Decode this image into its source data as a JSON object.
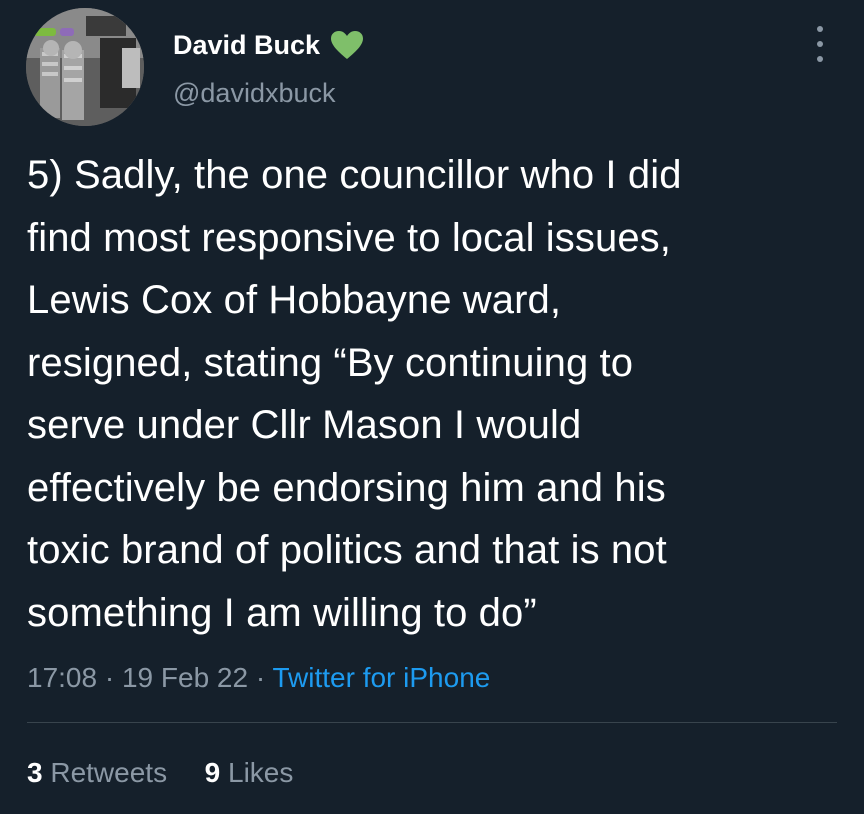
{
  "author": {
    "display_name": "David Buck",
    "handle": "@davidxbuck",
    "badge_icon": "green-heart-icon",
    "badge_color": "#7fbf6a"
  },
  "tweet": {
    "lines": [
      "5) Sadly, the one councillor who I did",
      "find most responsive to local issues,",
      "Lewis Cox of Hobbayne ward,",
      "resigned, stating “By continuing to",
      "serve under Cllr Mason I would",
      "effectively be endorsing him and his",
      "toxic brand of politics and that is not",
      "something I am willing to do”"
    ]
  },
  "meta": {
    "time": "17:08",
    "separator": "·",
    "date": "19 Feb 22",
    "source": "Twitter for iPhone"
  },
  "stats": {
    "retweets_count": "3",
    "retweets_label": "Retweets",
    "likes_count": "9",
    "likes_label": "Likes"
  },
  "colors": {
    "background": "#15202b",
    "text_primary": "#ffffff",
    "text_secondary": "#8b98a5",
    "link": "#1d9bf0",
    "divider": "#38444d"
  }
}
